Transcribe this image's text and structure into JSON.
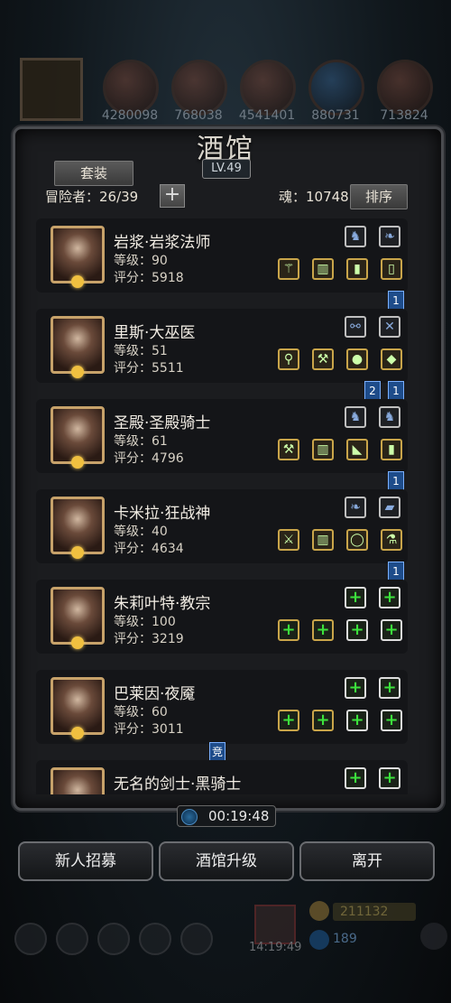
{
  "top_resources": [
    {
      "value": "4280098"
    },
    {
      "value": "768038"
    },
    {
      "value": "4541401"
    },
    {
      "value": "880731"
    },
    {
      "value": "713824"
    }
  ],
  "title": "酒馆",
  "level": "LV.49",
  "set_button": "套装",
  "adventurers_label": "冒险者：26/39",
  "plus": "+",
  "soul_label": "魂：10748",
  "sort_button": "排序",
  "heroes": [
    {
      "name": "岩浆·岩浆法师",
      "level": "等级：90",
      "score": "评分：5918",
      "tags": [
        "1"
      ]
    },
    {
      "name": "里斯·大巫医",
      "level": "等级：51",
      "score": "评分：5511",
      "tags": [
        "2",
        "1"
      ]
    },
    {
      "name": "圣殿·圣殿骑士",
      "level": "等级：61",
      "score": "评分：4796",
      "tags": [
        "1"
      ]
    },
    {
      "name": "卡米拉·狂战神",
      "level": "等级：40",
      "score": "评分：4634",
      "tags": [
        "1"
      ]
    },
    {
      "name": "朱莉叶特·教宗",
      "level": "等级：100",
      "score": "评分：3219",
      "tags": []
    },
    {
      "name": "巴莱因·夜魇",
      "level": "等级：60",
      "score": "评分：3011",
      "tags": [
        "竞"
      ]
    },
    {
      "name": "无名的剑士·黑骑士",
      "level": "",
      "score": "",
      "tags": []
    }
  ],
  "timer": "00:19:48",
  "buttons": {
    "recruit": "新人招募",
    "upgrade": "酒馆升级",
    "leave": "离开"
  },
  "bottom": {
    "time": "14:19:49",
    "coins": "211132",
    "gems": "189"
  },
  "colors": {
    "accent_gold": "#c7a26a",
    "tag_blue": "#1e4c8a",
    "plus_green": "#3ce23c"
  }
}
